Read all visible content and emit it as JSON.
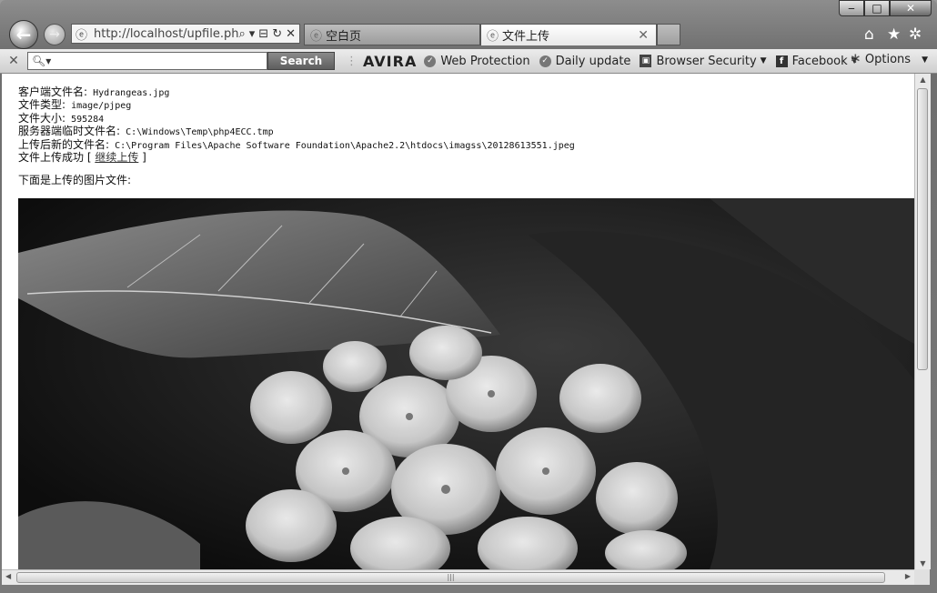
{
  "browser": {
    "caption": {
      "minimize": "‒",
      "maximize": "□",
      "close": "✕"
    },
    "address": {
      "url": "http://localhost/upfile.php",
      "search_icon": "⌕",
      "dropdown": "▾",
      "compat": "⊟",
      "refresh": "↻",
      "stop": "✕"
    },
    "tabs": [
      {
        "label": "空白页",
        "icon": "e-icon"
      },
      {
        "label": "文件上传",
        "icon": "e-icon",
        "close": "✕",
        "active": true
      }
    ],
    "right_icons": {
      "home": "⌂",
      "favorites": "★",
      "tools": "✲"
    }
  },
  "toolbar": {
    "close": "✕",
    "search_placeholder": "",
    "search_button": "Search",
    "brand": "AVIRA",
    "items": [
      {
        "label": "Web Protection",
        "icon": "check-circle-icon"
      },
      {
        "label": "Daily update",
        "icon": "check-circle-icon"
      },
      {
        "label": "Browser Security",
        "icon": "lock-icon"
      },
      {
        "label": "Facebook",
        "icon": "facebook-icon"
      }
    ],
    "options": "Options"
  },
  "page": {
    "lines": [
      {
        "label": "客户端文件名:",
        "value": " Hydrangeas.jpg"
      },
      {
        "label": "文件类型:",
        "value": " image/pjpeg"
      },
      {
        "label": "文件大小:",
        "value": " 595284"
      },
      {
        "label": "服务器端临时文件名:",
        "value": " C:\\Windows\\Temp\\php4ECC.tmp"
      },
      {
        "label": "上传后新的文件名:",
        "value": " C:\\Program Files\\Apache Software Foundation\\Apache2.2\\htdocs\\imagss\\20128613551.jpeg"
      }
    ],
    "success_text": "文件上传成功 [ ",
    "continue_link": "继续上传",
    "success_end": " ]",
    "below_text": "下面是上传的图片文件:"
  }
}
